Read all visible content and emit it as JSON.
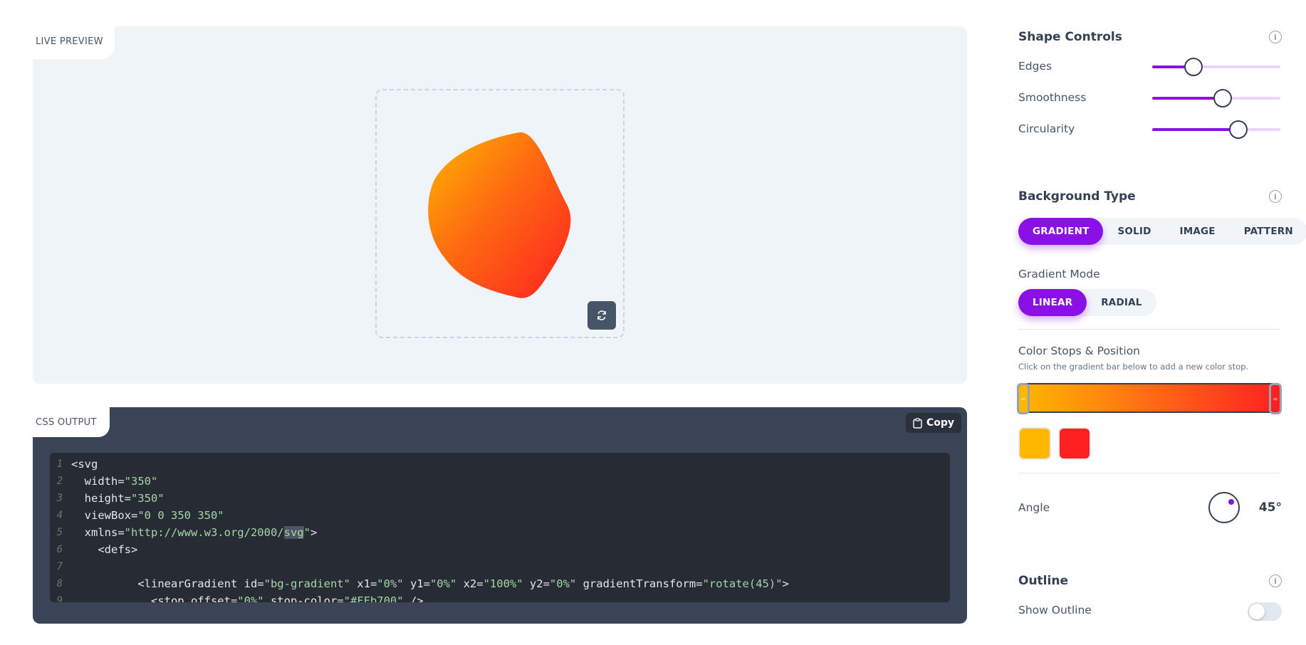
{
  "preview": {
    "tab_label": "LIVE PREVIEW",
    "gradient_start": "#FFb700",
    "gradient_end": "#FF2121"
  },
  "output": {
    "tab_label": "CSS OUTPUT",
    "copy_label": "Copy",
    "lines": [
      {
        "n": "1",
        "parts": [
          [
            "code",
            "<svg"
          ]
        ]
      },
      {
        "n": "2",
        "parts": [
          [
            "code",
            "  width="
          ],
          [
            "str",
            "\"350\""
          ]
        ]
      },
      {
        "n": "3",
        "parts": [
          [
            "code",
            "  height="
          ],
          [
            "str",
            "\"350\""
          ]
        ]
      },
      {
        "n": "4",
        "parts": [
          [
            "code",
            "  viewBox="
          ],
          [
            "str",
            "\"0 0 350 350\""
          ]
        ]
      },
      {
        "n": "5",
        "parts": [
          [
            "code",
            "  xmlns="
          ],
          [
            "str",
            "\"http://www.w3.org/2000/"
          ],
          [
            "hl",
            "svg"
          ],
          [
            "str",
            "\""
          ],
          [
            "code",
            ">"
          ]
        ]
      },
      {
        "n": "6",
        "parts": [
          [
            "code",
            "    <defs>"
          ]
        ]
      },
      {
        "n": "7",
        "parts": [
          [
            "code",
            ""
          ]
        ]
      },
      {
        "n": "8",
        "parts": [
          [
            "code",
            "          <linearGradient id="
          ],
          [
            "str",
            "\"bg-gradient\""
          ],
          [
            "code",
            " x1="
          ],
          [
            "str",
            "\"0%\""
          ],
          [
            "code",
            " y1="
          ],
          [
            "str",
            "\"0%\""
          ],
          [
            "code",
            " x2="
          ],
          [
            "str",
            "\"100%\""
          ],
          [
            "code",
            " y2="
          ],
          [
            "str",
            "\"0%\""
          ],
          [
            "code",
            " gradientTransform="
          ],
          [
            "str",
            "\"rotate(45)\""
          ],
          [
            "code",
            ">"
          ]
        ]
      },
      {
        "n": "9",
        "parts": [
          [
            "code",
            "            <stop offset="
          ],
          [
            "str",
            "\"0%\""
          ],
          [
            "code",
            " stop-color="
          ],
          [
            "str",
            "\"#FFb700\""
          ],
          [
            "code",
            " />"
          ]
        ]
      }
    ]
  },
  "shape_controls": {
    "title": "Shape Controls",
    "sliders": [
      {
        "label": "Edges",
        "value": 0.32
      },
      {
        "label": "Smoothness",
        "value": 0.55
      },
      {
        "label": "Circularity",
        "value": 0.67
      }
    ]
  },
  "background": {
    "title": "Background Type",
    "types": [
      "GRADIENT",
      "SOLID",
      "IMAGE",
      "PATTERN"
    ],
    "active_type": "GRADIENT",
    "mode_label": "Gradient Mode",
    "modes": [
      "LINEAR",
      "RADIAL"
    ],
    "active_mode": "LINEAR",
    "stops_label": "Color Stops & Position",
    "stops_hint": "Click on the gradient bar below to add a new color stop.",
    "stops": [
      {
        "color": "#FFB700",
        "position": 0
      },
      {
        "color": "#FF2121",
        "position": 100
      }
    ],
    "angle_label": "Angle",
    "angle_value": "45°"
  },
  "outline": {
    "title": "Outline",
    "show_label": "Show Outline",
    "enabled": false
  },
  "colors": {
    "accent": "#8B10E6",
    "dark": "#334155"
  }
}
